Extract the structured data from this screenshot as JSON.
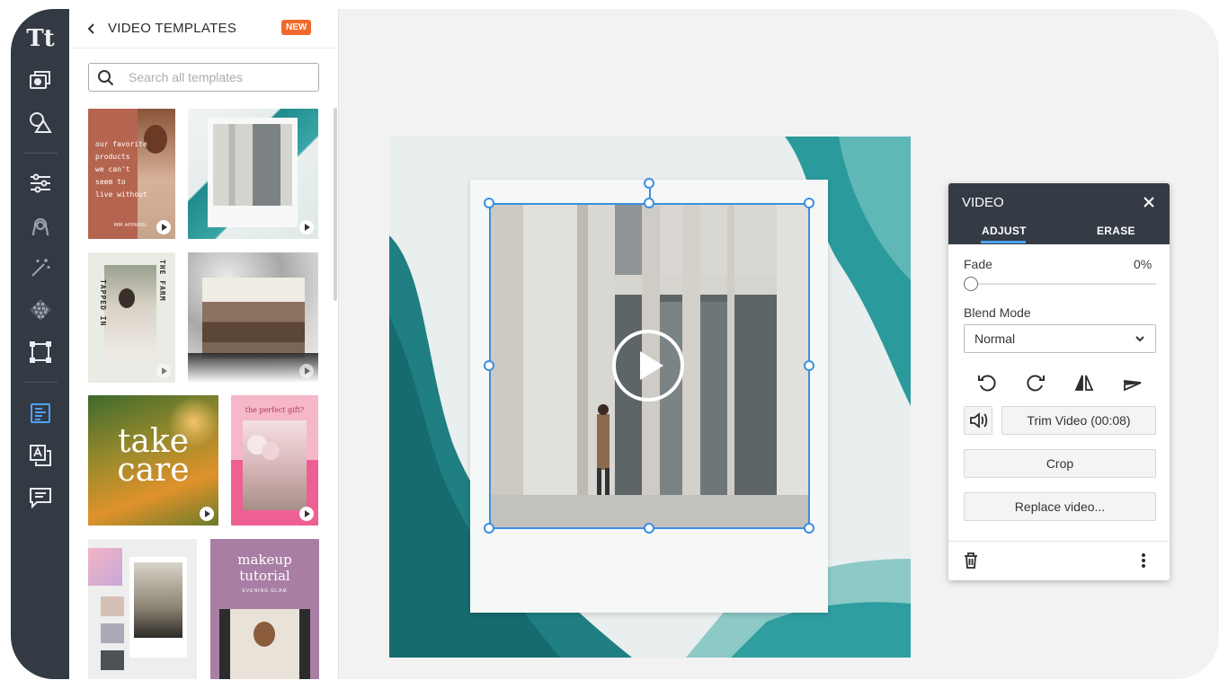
{
  "rail": {
    "text_tool": "Tt",
    "icons": [
      "text-icon",
      "photos-icon",
      "shapes-icon",
      "adjust-icon",
      "retouch-icon",
      "magic-wand-icon",
      "pattern-icon",
      "frame-icon",
      "templates-icon",
      "text-effects-icon",
      "comments-icon"
    ],
    "active": "templates-icon"
  },
  "panel": {
    "title": "VIDEO TEMPLATES",
    "badge": "NEW",
    "search_placeholder": "Search all templates"
  },
  "templates": [
    {
      "lines": [
        "our favorite",
        "products",
        "we can't",
        "seem to",
        "live without"
      ],
      "brand": "MM APPAREL",
      "has_play": true
    },
    {
      "has_play": true
    },
    {
      "vertical_left": "TAPPED IN",
      "vertical_right": "THE FARM",
      "has_play": true
    },
    {
      "has_play": true
    },
    {
      "big_text": "take care",
      "has_play": true
    },
    {
      "title": "the perfect gift?",
      "has_play": true
    },
    {},
    {
      "title": "makeup tutorial",
      "subtitle": "EVENING GLAM"
    }
  ],
  "video_panel": {
    "title": "VIDEO",
    "tabs": [
      "ADJUST",
      "ERASE"
    ],
    "active_tab": "ADJUST",
    "fade_label": "Fade",
    "fade_value": "0%",
    "fade_level": 0,
    "blend_label": "Blend Mode",
    "blend_value": "Normal",
    "trim_label": "Trim Video (00:08)",
    "crop_label": "Crop",
    "replace_label": "Replace video..."
  },
  "colors": {
    "rail": "#333a44",
    "accent": "#3b8fe0",
    "badge": "#f06a2d",
    "teal": "#1f8b8d"
  }
}
